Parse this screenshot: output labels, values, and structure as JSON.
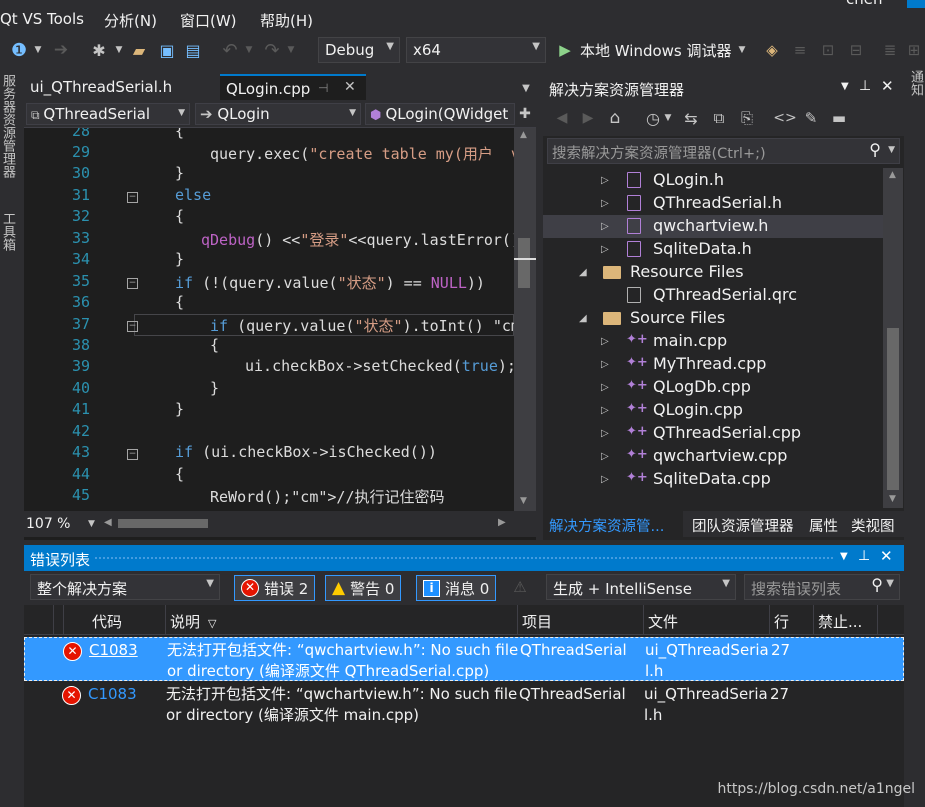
{
  "menubar": {
    "items": [
      "Qt VS Tools",
      "分析(N)",
      "窗口(W)",
      "帮助(H)"
    ],
    "user": "chen"
  },
  "toolbar": {
    "config": "Debug",
    "platform": "x64",
    "run_label": "本地 Windows 调试器"
  },
  "leftstrip": {
    "server_explorer": "服务器资源管理器",
    "toolbox": "工具箱"
  },
  "rightstrip": {
    "notifications": "通知"
  },
  "editor": {
    "tabs": [
      {
        "label": "ui_QThreadSerial.h"
      },
      {
        "label": "QLogin.cpp",
        "active": true
      }
    ],
    "nav": {
      "project": "QThreadSerial",
      "class": "QLogin",
      "member": "QLogin(QWidget"
    },
    "zoom": "107 %",
    "lines": [
      {
        "n": "28",
        "text": "{"
      },
      {
        "n": "29",
        "text": "query.exec(\"create table my(用户  va"
      },
      {
        "n": "30",
        "text": "}"
      },
      {
        "n": "31",
        "text": "else"
      },
      {
        "n": "32",
        "text": "{"
      },
      {
        "n": "33",
        "text": "qDebug() <<\"登录\"<<query.lastError()"
      },
      {
        "n": "34",
        "text": "}"
      },
      {
        "n": "35",
        "text": "if (!(query.value(\"状态\") == NULL))"
      },
      {
        "n": "36",
        "text": "{"
      },
      {
        "n": "37",
        "text": "if (query.value(\"状态\").toInt() //"
      },
      {
        "n": "38",
        "text": "{"
      },
      {
        "n": "39",
        "text": "ui.checkBox->setChecked(true);"
      },
      {
        "n": "40",
        "text": "}"
      },
      {
        "n": "41",
        "text": "}"
      },
      {
        "n": "42",
        "text": ""
      },
      {
        "n": "43",
        "text": "if (ui.checkBox->isChecked())"
      },
      {
        "n": "44",
        "text": "{"
      },
      {
        "n": "45",
        "text": "ReWord();//执行记住密码"
      }
    ]
  },
  "solution_explorer": {
    "title": "解决方案资源管理器",
    "search_placeholder": "搜索解决方案资源管理器(Ctrl+;)",
    "items": [
      {
        "label": "QLogin.h",
        "kind": "h",
        "level": 2
      },
      {
        "label": "QThreadSerial.h",
        "kind": "h",
        "level": 2
      },
      {
        "label": "qwchartview.h",
        "kind": "h",
        "level": 2,
        "selected": true
      },
      {
        "label": "SqliteData.h",
        "kind": "h",
        "level": 2
      },
      {
        "label": "Resource Files",
        "kind": "folder",
        "level": 1
      },
      {
        "label": "QThreadSerial.qrc",
        "kind": "file",
        "level": 2
      },
      {
        "label": "Source Files",
        "kind": "folder",
        "level": 1
      },
      {
        "label": "main.cpp",
        "kind": "cpp",
        "level": 2
      },
      {
        "label": "MyThread.cpp",
        "kind": "cpp",
        "level": 2
      },
      {
        "label": "QLogDb.cpp",
        "kind": "cpp",
        "level": 2
      },
      {
        "label": "QLogin.cpp",
        "kind": "cpp",
        "level": 2
      },
      {
        "label": "QThreadSerial.cpp",
        "kind": "cpp",
        "level": 2
      },
      {
        "label": "qwchartview.cpp",
        "kind": "cpp",
        "level": 2
      },
      {
        "label": "SqliteData.cpp",
        "kind": "cpp",
        "level": 2
      }
    ],
    "bottom_tabs": [
      "解决方案资源管...",
      "团队资源管理器",
      "属性",
      "类视图"
    ]
  },
  "error_list": {
    "title": "错误列表",
    "scope": "整个解决方案",
    "errors_btn": "错误 2",
    "warnings_btn": "警告 0",
    "messages_btn": "消息 0",
    "source": "生成 + IntelliSense",
    "search_placeholder": "搜索错误列表",
    "columns": [
      "代码",
      "说明",
      "项目",
      "文件",
      "行",
      "禁止..."
    ],
    "rows": [
      {
        "code": "C1083",
        "desc": "无法打开包括文件: “qwchartview.h”: No such file\nor directory (编译源文件 QThreadSerial.cpp)",
        "project": "QThreadSerial",
        "file": "ui_QThreadSeria\nl.h",
        "line": "27",
        "selected": true
      },
      {
        "code": "C1083",
        "desc": "无法打开包括文件: “qwchartview.h”: No such file\nor directory (编译源文件 main.cpp)",
        "project": "QThreadSerial",
        "file": "ui_QThreadSeria\nl.h",
        "line": "27",
        "selected": false
      }
    ]
  },
  "watermark": "https://blog.csdn.net/a1ngel"
}
